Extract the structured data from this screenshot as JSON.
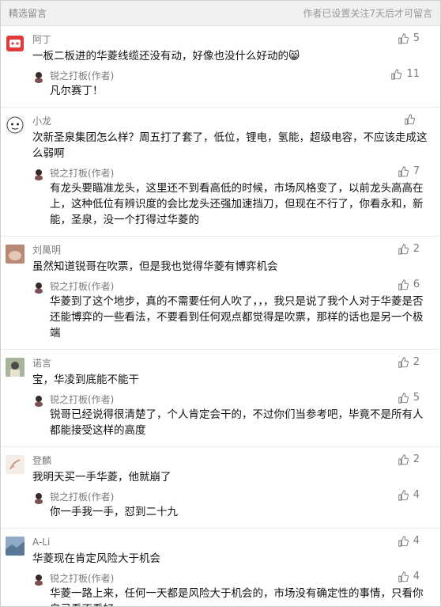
{
  "header": {
    "title": "精选留言",
    "notice": "作者已设置关注7天后才可留言"
  },
  "comments": [
    {
      "name": "阿丁",
      "text": "一板二板进的华菱线缆还没有动，好像也没什么好动的😸",
      "likes": "5",
      "reply": {
        "name": "锐之打板(作者)",
        "text": "凡尔赛丁！",
        "likes": "11"
      }
    },
    {
      "name": "小龙",
      "text": "次新圣泉集团怎么样？周五打了套了，低位，锂电，氢能，超级电容，不应该走成这么弱啊",
      "likes": "",
      "reply": {
        "name": "锐之打板(作者)",
        "text": "有龙头要瞄准龙头，这里还不到看高低的时候，市场风格变了，以前龙头高高在上，这种低位有辨识度的会比龙头还强加速挡刀，但现在不行了，你看永和，新能，圣泉，没一个打得过华菱的",
        "likes": "7"
      }
    },
    {
      "name": "刘萬明",
      "text": "虽然知道锐哥在吹票，但是我也觉得华菱有博弈机会",
      "likes": "2",
      "reply": {
        "name": "锐之打板(作者)",
        "text": "华菱到了这个地步，真的不需要任何人吹了，，，我只是说了我个人对于华菱是否还能博弈的一些看法，不要看到任何观点都觉得是吹票，那样的话也是另一个极端",
        "likes": "6"
      }
    },
    {
      "name": "诺言",
      "text": "宝，华凌到底能不能干",
      "likes": "2",
      "reply": {
        "name": "锐之打板(作者)",
        "text": "锐哥已经说得很清楚了，个人肯定会干的，不过你们当参考吧，毕竟不是所有人都能接受这样的高度",
        "likes": "5"
      }
    },
    {
      "name": "登麟",
      "text": "我明天买一手华菱，他就崩了",
      "likes": "2",
      "reply": {
        "name": "锐之打板(作者)",
        "text": "你一手我一手，怼到二十九",
        "likes": "4"
      }
    },
    {
      "name": "A-Li",
      "text": "华菱现在肯定风险大于机会",
      "likes": "4",
      "reply": {
        "name": "锐之打板(作者)",
        "text": "华菱一路上来，任何一天都是风险大于机会的，市场没有确定性的事情，只看你自己看不看好",
        "likes": "4"
      }
    }
  ]
}
